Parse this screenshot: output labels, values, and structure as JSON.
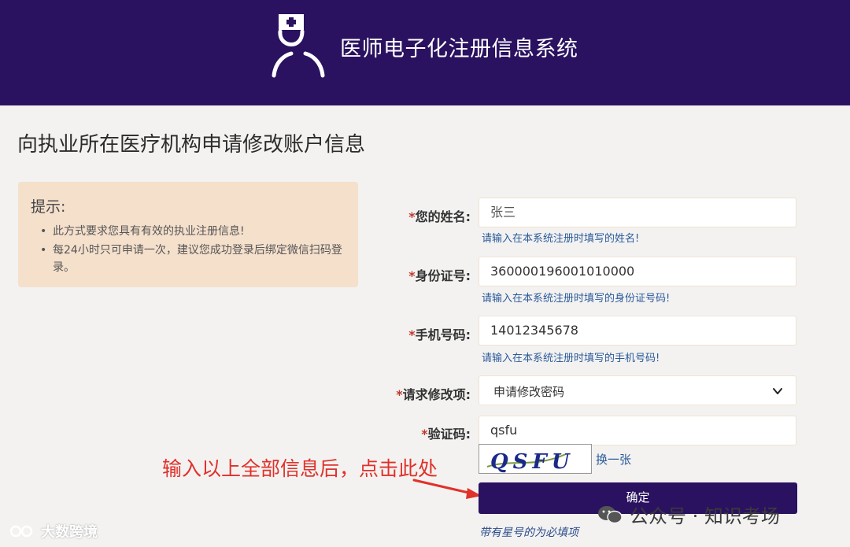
{
  "header": {
    "title": "医师电子化注册信息系统",
    "logo_icon": "doctor-nurse-cap-icon"
  },
  "page_title": "向执业所在医疗机构申请修改账户信息",
  "tip": {
    "title": "提示:",
    "items": [
      "此方式要求您具有有效的执业注册信息!",
      "每24小时只可申请一次，建议您成功登录后绑定微信扫码登录。"
    ]
  },
  "form": {
    "name": {
      "star": "*",
      "label": "您的姓名:",
      "value": "张三",
      "hint": "请输入在本系统注册时填写的姓名!"
    },
    "id_number": {
      "star": "*",
      "label": "身份证号:",
      "value": "360000196001010000",
      "hint": "请输入在本系统注册时填写的身份证号码!"
    },
    "phone": {
      "star": "*",
      "label": "手机号码:",
      "value": "14012345678",
      "hint": "请输入在本系统注册时填写的手机号码!"
    },
    "request_type": {
      "star": "*",
      "label": "请求修改项:",
      "selected": "申请修改密码"
    },
    "captcha": {
      "star": "*",
      "label": "验证码:",
      "value": "qsfu",
      "image_text": "QSFU",
      "refresh_label": "换一张"
    },
    "submit_label": "确定",
    "required_note": "带有星号的为必填项"
  },
  "annotation": {
    "text": "输入以上全部信息后，点击此处",
    "color": "#e0312a"
  },
  "watermarks": {
    "left": "大数跨境",
    "right": "公众号 · 知识考场"
  },
  "colors": {
    "brand": "#2a1260",
    "tip_bg": "#f5e0cc",
    "hint": "#2a5a9a",
    "required": "#c0392b"
  }
}
